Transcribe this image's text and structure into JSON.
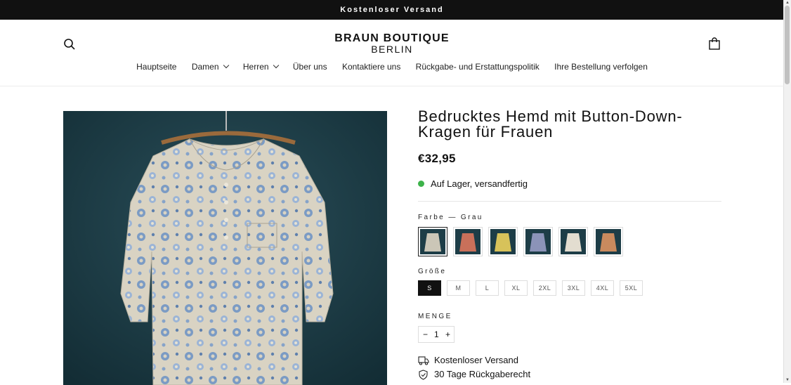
{
  "announcement": "Kostenloser Versand",
  "brand": {
    "line1": "BRAUN BOUTIQUE",
    "line2": "BERLIN"
  },
  "nav": [
    {
      "label": "Hauptseite"
    },
    {
      "label": "Damen"
    },
    {
      "label": "Herren"
    },
    {
      "label": "Über uns"
    },
    {
      "label": "Kontaktiere uns"
    },
    {
      "label": "Rückgabe- und Erstattungspolitik"
    },
    {
      "label": "Ihre Bestellung verfolgen"
    }
  ],
  "product": {
    "title": "Bedrucktes Hemd mit Button-Down-Kragen für Frauen",
    "price": "€32,95",
    "stock": "Auf Lager, versandfertig",
    "color_label": "Farbe",
    "color_separator": "—",
    "color_value": "Grau",
    "size_label": "Größe",
    "sizes": [
      "S",
      "M",
      "L",
      "XL",
      "2XL",
      "3XL",
      "4XL",
      "5XL"
    ],
    "selected_size": "S",
    "quantity_label": "MENGE",
    "quantity": "1",
    "minus": "−",
    "plus": "+"
  },
  "features": [
    {
      "icon": "truck-icon",
      "text": "Kostenloser Versand"
    },
    {
      "icon": "shield-check-icon",
      "text": "30 Tage Rückgaberecht"
    }
  ],
  "colors": {
    "stock_dot": "#3db34a",
    "announcement_bg": "#111111",
    "selected_size_bg": "#111111"
  }
}
